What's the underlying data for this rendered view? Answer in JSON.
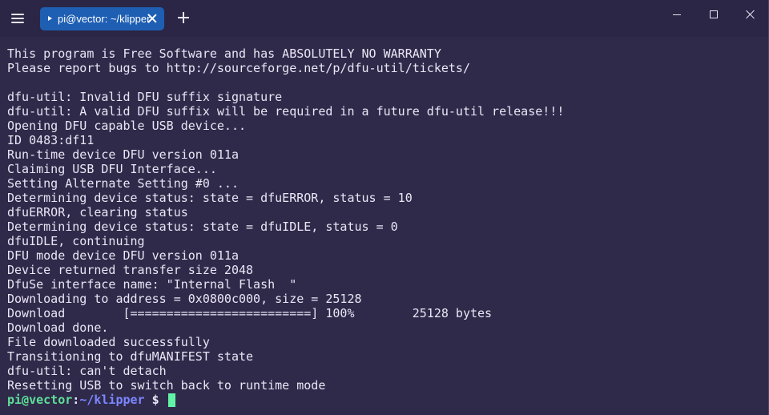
{
  "titlebar": {
    "tab_title": "pi@vector: ~/klipper"
  },
  "terminal": {
    "lines": [
      "This program is Free Software and has ABSOLUTELY NO WARRANTY",
      "Please report bugs to http://sourceforge.net/p/dfu-util/tickets/",
      "",
      "dfu-util: Invalid DFU suffix signature",
      "dfu-util: A valid DFU suffix will be required in a future dfu-util release!!!",
      "Opening DFU capable USB device...",
      "ID 0483:df11",
      "Run-time device DFU version 011a",
      "Claiming USB DFU Interface...",
      "Setting Alternate Setting #0 ...",
      "Determining device status: state = dfuERROR, status = 10",
      "dfuERROR, clearing status",
      "Determining device status: state = dfuIDLE, status = 0",
      "dfuIDLE, continuing",
      "DFU mode device DFU version 011a",
      "Device returned transfer size 2048",
      "DfuSe interface name: \"Internal Flash  \"",
      "Downloading to address = 0x0800c000, size = 25128",
      "Download        [=========================] 100%        25128 bytes",
      "Download done.",
      "File downloaded successfully",
      "Transitioning to dfuMANIFEST state",
      "dfu-util: can't detach",
      "Resetting USB to switch back to runtime mode"
    ],
    "prompt": {
      "user_host": "pi@vector",
      "separator": ":",
      "path": "~/klipper",
      "symbol": " $ "
    }
  },
  "colors": {
    "background": "#2f2a4a",
    "tab_active": "#1e5fb3",
    "prompt_user": "#5ee098",
    "prompt_path": "#7d86ff",
    "cursor": "#62f2a6",
    "text": "#eae6f5"
  },
  "icons": {
    "menu": "hamburger-menu-icon",
    "tab": "terminal-icon",
    "tab_close": "close-icon",
    "new_tab": "plus-icon",
    "minimize": "minimize-icon",
    "maximize": "maximize-icon",
    "close": "close-icon"
  }
}
